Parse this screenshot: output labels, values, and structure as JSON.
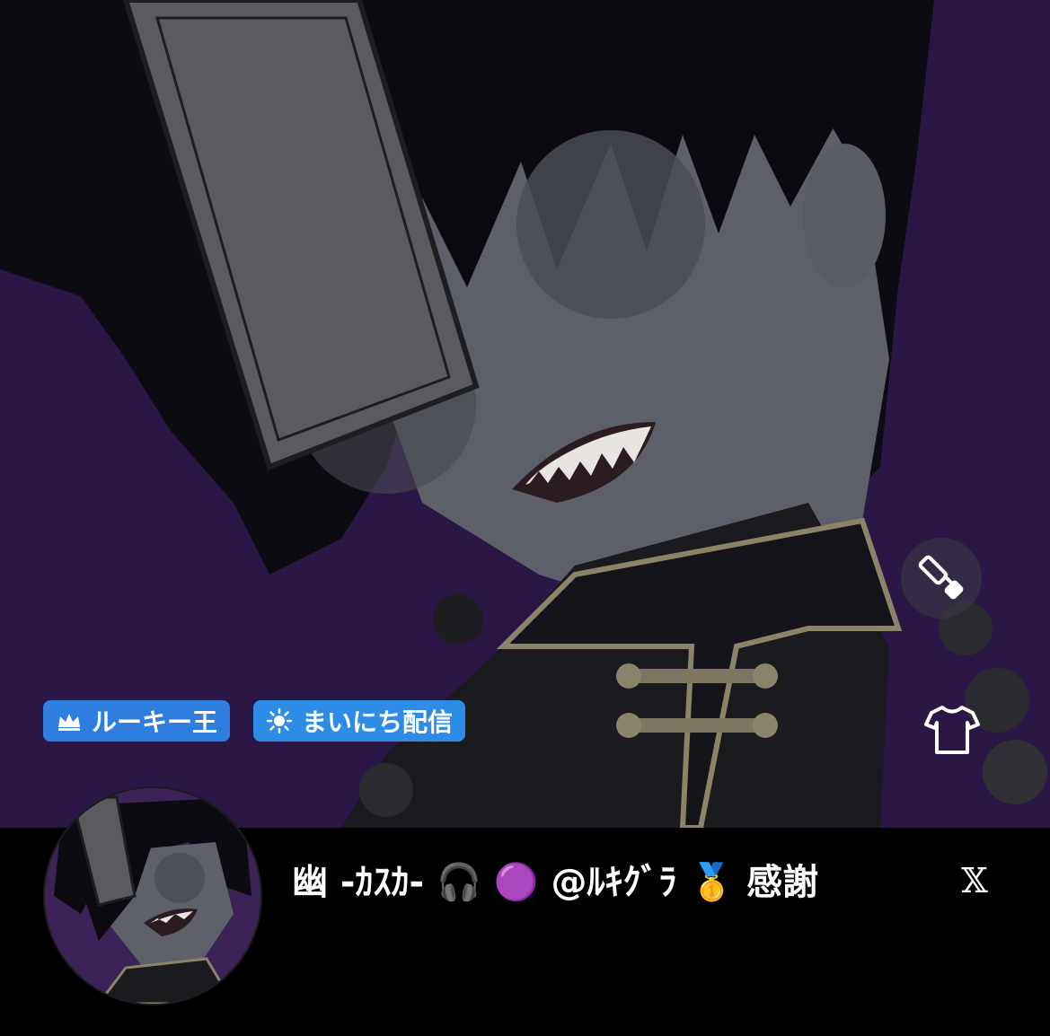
{
  "badges": [
    {
      "label": "ルーキー王",
      "icon": "crown-icon",
      "color": "#2e7ee0"
    },
    {
      "label": "まいにち配信",
      "icon": "sun-icon",
      "color": "#2e8ce6"
    }
  ],
  "profile": {
    "display_name": "幽 -ｶｽｶ- 🎧 🟣 @ﾙｷｸﾞﾗ 🥇 感謝"
  },
  "actions": {
    "customize_icon": "paint-roller-icon",
    "outfit_icon": "tshirt-icon",
    "social_label": "𝕏"
  },
  "colors": {
    "background": "#2a1745",
    "bar": "#000000",
    "badge": "#2e7ee0"
  }
}
